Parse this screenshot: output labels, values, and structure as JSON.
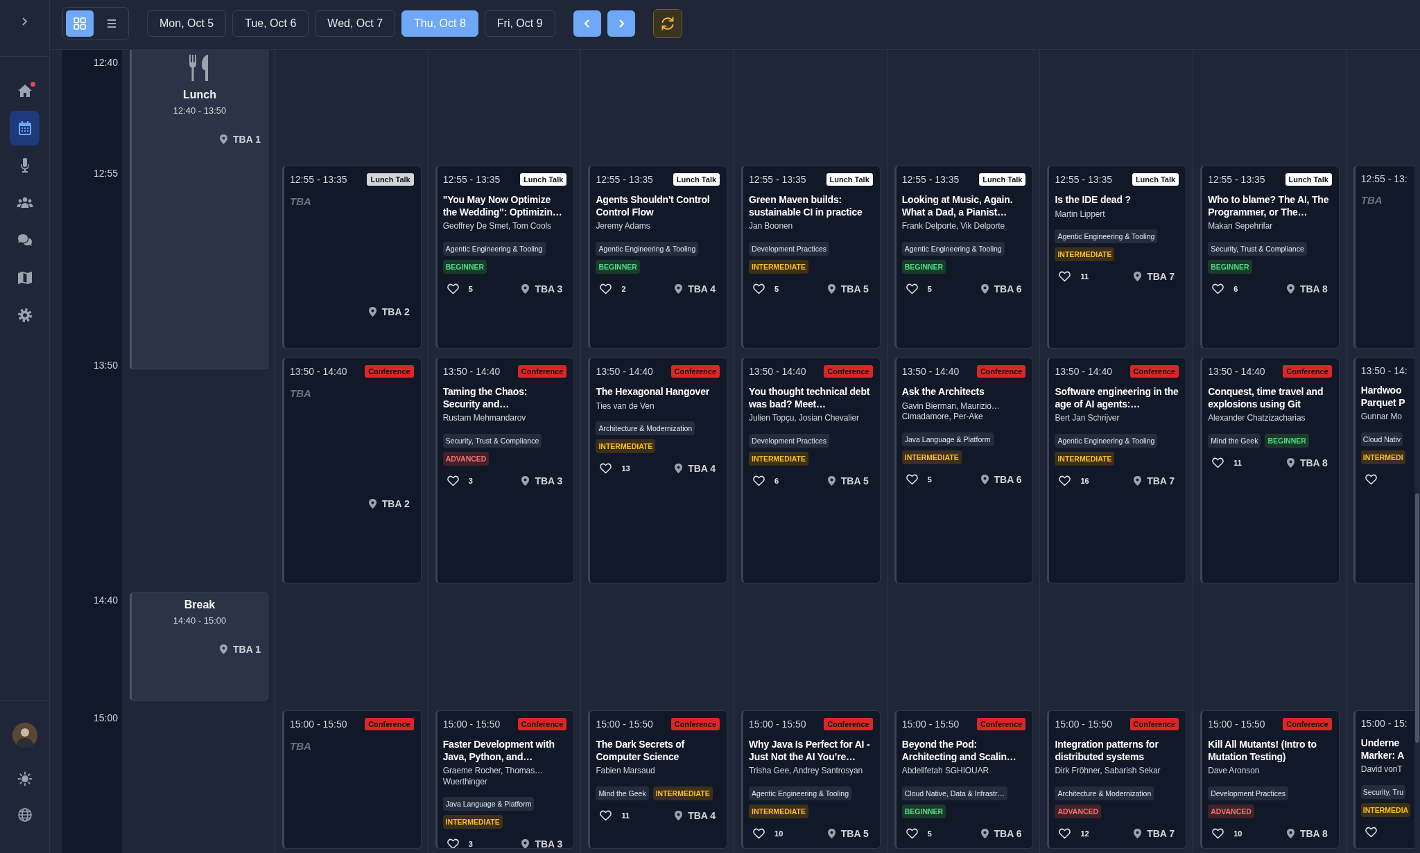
{
  "sidebar": {
    "nav": [
      {
        "selected": false,
        "notification": true
      },
      {
        "selected": true,
        "notification": false
      },
      {
        "selected": false,
        "notification": false
      },
      {
        "selected": false,
        "notification": false
      },
      {
        "selected": false,
        "notification": false
      },
      {
        "selected": false,
        "notification": false
      },
      {
        "selected": false,
        "notification": false
      }
    ]
  },
  "view_toggle": [
    {
      "selected": true
    },
    {
      "selected": false
    }
  ],
  "days": [
    {
      "label": "Mon, Oct 5",
      "selected": false
    },
    {
      "label": "Tue, Oct 6",
      "selected": false
    },
    {
      "label": "Wed, Oct 7",
      "selected": false
    },
    {
      "label": "Thu, Oct 8",
      "selected": true
    },
    {
      "label": "Fri, Oct 9",
      "selected": false
    }
  ],
  "rows": [
    {
      "time": "12:40",
      "break": {
        "kind": "lunch",
        "title": "Lunch",
        "time": "12:40 - 13:50",
        "room": "TBA 1"
      }
    },
    {
      "time": "12:55",
      "sessions": [
        {
          "kind": "tba",
          "time": "12:55 - 13:35",
          "tag": {
            "label": "Lunch Talk",
            "kind": "lunch_talk"
          },
          "title": "TBA",
          "room": "TBA 2"
        },
        {
          "kind": "talk",
          "time": "12:55 - 13:35",
          "tag": {
            "label": "Lunch Talk",
            "kind": "lunch_talk"
          },
          "title": "\"You May Now Optimize the Wedding\": Optimizin…",
          "speakers": "Geoffrey De Smet, Tom Cools",
          "tracks": [
            "Agentic Engineering & Tooling"
          ],
          "difficulty": {
            "label": "BEGINNER",
            "kind": "beginner"
          },
          "likes": "5",
          "room": "TBA 3"
        },
        {
          "kind": "talk",
          "time": "12:55 - 13:35",
          "tag": {
            "label": "Lunch Talk",
            "kind": "lunch_talk"
          },
          "title": "Agents Shouldn't Control Control Flow",
          "speakers": "Jeremy Adams",
          "tracks": [
            "Agentic Engineering & Tooling"
          ],
          "difficulty": {
            "label": "BEGINNER",
            "kind": "beginner"
          },
          "likes": "2",
          "room": "TBA 4"
        },
        {
          "kind": "talk",
          "time": "12:55 - 13:35",
          "tag": {
            "label": "Lunch Talk",
            "kind": "lunch_talk"
          },
          "title": "Green Maven builds: sustainable CI in practice",
          "speakers": "Jan Boonen",
          "tracks": [
            "Development Practices"
          ],
          "difficulty": {
            "label": "INTERMEDIATE",
            "kind": "intermediate"
          },
          "likes": "5",
          "room": "TBA 5"
        },
        {
          "kind": "talk",
          "time": "12:55 - 13:35",
          "tag": {
            "label": "Lunch Talk",
            "kind": "lunch_talk"
          },
          "title": "Looking at Music, Again. What a Dad, a Pianist…",
          "speakers": "Frank Delporte, Vik Delporte",
          "tracks": [
            "Agentic Engineering & Tooling"
          ],
          "difficulty": {
            "label": "BEGINNER",
            "kind": "beginner"
          },
          "likes": "5",
          "room": "TBA 6"
        },
        {
          "kind": "talk",
          "time": "12:55 - 13:35",
          "tag": {
            "label": "Lunch Talk",
            "kind": "lunch_talk"
          },
          "title": "Is the IDE dead ?",
          "speakers": "Martin Lippert",
          "tracks": [
            "Agentic Engineering & Tooling"
          ],
          "difficulty": {
            "label": "INTERMEDIATE",
            "kind": "intermediate"
          },
          "likes": "11",
          "room": "TBA 7"
        },
        {
          "kind": "talk",
          "time": "12:55 - 13:35",
          "tag": {
            "label": "Lunch Talk",
            "kind": "lunch_talk"
          },
          "title": "Who to blame? The AI, The Programmer, or The…",
          "speakers": "Makan Sepehrifar",
          "tracks": [
            "Security, Trust & Compliance"
          ],
          "difficulty": {
            "label": "BEGINNER",
            "kind": "beginner"
          },
          "likes": "6",
          "room": "TBA 8"
        },
        {
          "kind": "tba",
          "time": "12:55 - 13:",
          "title": "TBA"
        }
      ]
    },
    {
      "time": "13:50",
      "sessions": [
        {
          "kind": "tba",
          "time": "13:50 - 14:40",
          "tag": {
            "label": "Conference",
            "kind": "conference"
          },
          "title": "TBA",
          "room": "TBA 2"
        },
        {
          "kind": "talk",
          "time": "13:50 - 14:40",
          "tag": {
            "label": "Conference",
            "kind": "conference"
          },
          "title": "Taming the Chaos: Security and…",
          "speakers": "Rustam Mehmandarov",
          "tracks": [
            "Security, Trust & Compliance"
          ],
          "difficulty": {
            "label": "ADVANCED",
            "kind": "advanced"
          },
          "likes": "3",
          "room": "TBA 3"
        },
        {
          "kind": "talk",
          "time": "13:50 - 14:40",
          "tag": {
            "label": "Conference",
            "kind": "conference"
          },
          "title": "The Hexagonal Hangover",
          "speakers": "Ties van de Ven",
          "tracks": [
            "Architecture & Modernization"
          ],
          "difficulty": {
            "label": "INTERMEDIATE",
            "kind": "intermediate"
          },
          "likes": "13",
          "room": "TBA 4"
        },
        {
          "kind": "talk",
          "time": "13:50 - 14:40",
          "tag": {
            "label": "Conference",
            "kind": "conference"
          },
          "title": "You thought technical debt was bad? Meet…",
          "speakers": "Julien Topçu, Josian Chevalier",
          "tracks": [
            "Development Practices"
          ],
          "difficulty": {
            "label": "INTERMEDIATE",
            "kind": "intermediate"
          },
          "likes": "6",
          "room": "TBA 5"
        },
        {
          "kind": "talk",
          "time": "13:50 - 14:40",
          "tag": {
            "label": "Conference",
            "kind": "conference"
          },
          "title": "Ask the Architects",
          "speakers": "Gavin Bierman, Maurizio… Cimadamore, Per-Ake",
          "tracks": [
            "Java Language & Platform"
          ],
          "difficulty": {
            "label": "INTERMEDIATE",
            "kind": "intermediate"
          },
          "likes": "5",
          "room": "TBA 6"
        },
        {
          "kind": "talk",
          "time": "13:50 - 14:40",
          "tag": {
            "label": "Conference",
            "kind": "conference"
          },
          "title": "Software engineering in the age of AI agents:…",
          "speakers": "Bert Jan Schrijver",
          "tracks": [
            "Agentic Engineering & Tooling"
          ],
          "difficulty": {
            "label": "INTERMEDIATE",
            "kind": "intermediate"
          },
          "likes": "16",
          "room": "TBA 7"
        },
        {
          "kind": "talk",
          "time": "13:50 - 14:40",
          "tag": {
            "label": "Conference",
            "kind": "conference"
          },
          "title": "Conquest, time travel and explosions using Git",
          "speakers": "Alexander Chatzizacharias",
          "tracks": [
            "Mind the Geek"
          ],
          "difficulty": {
            "label": "BEGINNER",
            "kind": "beginner"
          },
          "likes": "11",
          "room": "TBA 8"
        },
        {
          "kind": "talk",
          "time": "13:50 - 14:",
          "title": "Hardwoo Parquet P",
          "speakers": "Gunnar Mo",
          "tracks": [
            "Cloud Nativ"
          ],
          "difficulty": {
            "label": "INTERMEDI",
            "kind": "intermediate"
          }
        }
      ]
    },
    {
      "time": "14:40",
      "break": {
        "kind": "break",
        "title": "Break",
        "time": "14:40 - 15:00",
        "room": "TBA 1"
      }
    },
    {
      "time": "15:00",
      "sessions": [
        {
          "kind": "tba",
          "time": "15:00 - 15:50",
          "tag": {
            "label": "Conference",
            "kind": "conference"
          },
          "title": "TBA"
        },
        {
          "kind": "talk",
          "time": "15:00 - 15:50",
          "tag": {
            "label": "Conference",
            "kind": "conference"
          },
          "title": "Faster Development with Java, Python, and…",
          "speakers": "Graeme Rocher, Thomas… Wuerthinger",
          "tracks": [
            "Java Language & Platform"
          ],
          "difficulty": {
            "label": "INTERMEDIATE",
            "kind": "intermediate"
          },
          "likes": "3",
          "room": "TBA 3"
        },
        {
          "kind": "talk",
          "time": "15:00 - 15:50",
          "tag": {
            "label": "Conference",
            "kind": "conference"
          },
          "title": "The Dark Secrets of Computer Science",
          "speakers": "Fabien Marsaud",
          "tracks": [
            "Mind the Geek"
          ],
          "difficulty": {
            "label": "INTERMEDIATE",
            "kind": "intermediate"
          },
          "likes": "11",
          "room": "TBA 4"
        },
        {
          "kind": "talk",
          "time": "15:00 - 15:50",
          "tag": {
            "label": "Conference",
            "kind": "conference"
          },
          "title": "Why Java Is Perfect for AI - Just Not the AI You’re…",
          "speakers": "Trisha Gee, Andrey Santrosyan",
          "tracks": [
            "Agentic Engineering & Tooling"
          ],
          "difficulty": {
            "label": "INTERMEDIATE",
            "kind": "intermediate"
          },
          "likes": "10",
          "room": "TBA 5"
        },
        {
          "kind": "talk",
          "time": "15:00 - 15:50",
          "tag": {
            "label": "Conference",
            "kind": "conference"
          },
          "title": "Beyond the Pod: Architecting and Scalin…",
          "speakers": "Abdellfetah SGHIOUAR",
          "tracks": [
            "Cloud Native, Data & Infrastr…"
          ],
          "difficulty": {
            "label": "BEGINNER",
            "kind": "beginner"
          },
          "likes": "5",
          "room": "TBA 6"
        },
        {
          "kind": "talk",
          "time": "15:00 - 15:50",
          "tag": {
            "label": "Conference",
            "kind": "conference"
          },
          "title": "Integration patterns for distributed systems",
          "speakers": "Dirk Fröhner, Sabarish Sekar",
          "tracks": [
            "Architecture & Modernization"
          ],
          "difficulty": {
            "label": "ADVANCED",
            "kind": "advanced"
          },
          "likes": "12",
          "room": "TBA 7"
        },
        {
          "kind": "talk",
          "time": "15:00 - 15:50",
          "tag": {
            "label": "Conference",
            "kind": "conference"
          },
          "title": "Kill All Mutants! (Intro to Mutation Testing)",
          "speakers": "Dave Aronson",
          "tracks": [
            "Development Practices"
          ],
          "difficulty": {
            "label": "ADVANCED",
            "kind": "advanced"
          },
          "likes": "10",
          "room": "TBA 8"
        },
        {
          "kind": "talk",
          "time": "15:00 - 15:",
          "title": "Underne Marker: A",
          "speakers": "David vonT",
          "tracks": [
            "Security, Tru"
          ],
          "difficulty": {
            "label": "INTERMEDIA",
            "kind": "intermediate"
          }
        }
      ]
    }
  ]
}
